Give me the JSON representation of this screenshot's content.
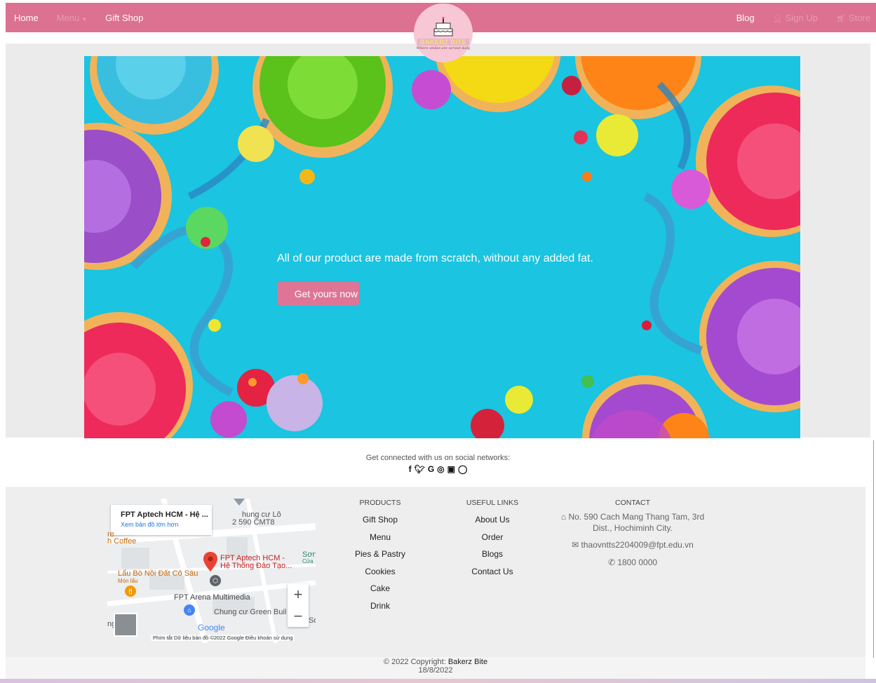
{
  "nav": {
    "home": "Home",
    "menu": "Menu",
    "gift_shop": "Gift Shop",
    "blog": "Blog",
    "sign_up": "Sign Up",
    "store": "Store"
  },
  "logo": {
    "name": "BAKERZ BITE",
    "tagline": "Where smiles are served daily"
  },
  "hero": {
    "text": "All of our product are made from scratch, without any added fat.",
    "button": "Get yours now"
  },
  "social": {
    "text": "Get connected with us on social networks:",
    "icons": [
      "facebook-icon",
      "twitter-icon",
      "google-icon",
      "instagram-icon",
      "linkedin-icon",
      "github-icon"
    ]
  },
  "map": {
    "place_title": "FPT Aptech HCM - Hệ ...",
    "larger_map": "Xem bản đồ lớn hơn",
    "labels": {
      "chung_cu_lo": "hung cư Lô",
      "cmt8": "2 590 CMT8",
      "re": "re",
      "coffee": "h Coffee",
      "pin_title": "FPT Aptech HCM -",
      "pin_subtitle": "Hệ Thống Đào Tạo...",
      "son": "Sơn",
      "cua": "Cửa",
      "lau_bo": "Lẩu Bò Nồi Đất Cô Sáu",
      "mon_lau": "Món lẩu",
      "arena": "FPT Arena Multimedia",
      "green": "Chung cư Green Buil",
      "google": "Google",
      "so": "So",
      "ng": "ng"
    },
    "zoom_in": "+",
    "zoom_out": "−",
    "attribution": "Phím tắt   Dữ liệu bản đồ ©2022 Google   Điều khoản sử dụng"
  },
  "footer": {
    "products": {
      "heading": "PRODUCTS",
      "items": [
        "Gift Shop",
        "Menu",
        "Pies & Pastry",
        "Cookies",
        "Cake",
        "Drink"
      ]
    },
    "useful_links": {
      "heading": "USEFUL LINKS",
      "items": [
        "About Us",
        "Order",
        "Blogs",
        "Contact Us"
      ]
    },
    "contact": {
      "heading": "CONTACT",
      "address": "No. 590 Cach Mang Thang Tam, 3rd Dist., Hochiminh City.",
      "email": "thaovntts2204009@fpt.edu.vn",
      "phone": "1800 0000"
    }
  },
  "copyright": {
    "text": "© 2022 Copyright: ",
    "brand": "Bakerz Bite",
    "date": "18/8/2022"
  },
  "colors": {
    "navbar": "#dc7192",
    "hero_bg": "#1bc4e0",
    "button": "#de7596",
    "footer_bg": "#eeeeee"
  }
}
